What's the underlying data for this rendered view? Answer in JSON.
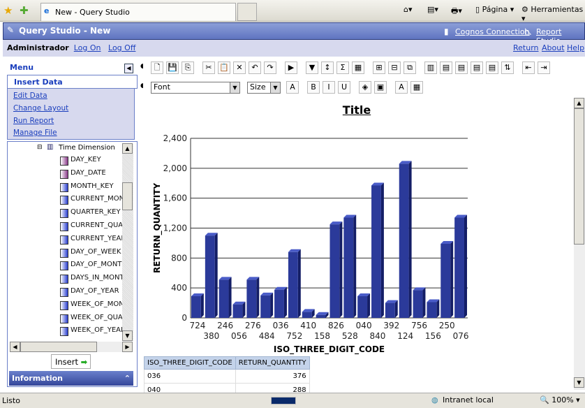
{
  "browser": {
    "tab_title": "New - Query Studio",
    "pagina": "Página",
    "herramientas": "Herramientas"
  },
  "header": {
    "title": "Query Studio - New",
    "cognos_connection": "Cognos Connection",
    "report_studio": "Report Studio"
  },
  "userbar": {
    "user": "Administrador",
    "log_on": "Log On",
    "log_off": "Log Off",
    "return": "Return",
    "about": "About",
    "help": "Help"
  },
  "menu": {
    "title": "Menu",
    "items": [
      "Insert Data",
      "Edit Data",
      "Change Layout",
      "Run Report",
      "Manage File"
    ]
  },
  "tree": {
    "root": "Time Dimension",
    "items": [
      "DAY_KEY",
      "DAY_DATE",
      "MONTH_KEY",
      "CURRENT_MONTH",
      "QUARTER_KEY",
      "CURRENT_QUARTER",
      "CURRENT_YEAR",
      "DAY_OF_WEEK",
      "DAY_OF_MONTH",
      "DAYS_IN_MONTH",
      "DAY_OF_YEAR",
      "WEEK_OF_MONTH",
      "WEEK_OF_QUARTER",
      "WEEK_OF_YEAR"
    ]
  },
  "insert_label": "Insert",
  "information_label": "Information",
  "format": {
    "font": "Font",
    "size": "Size"
  },
  "report": {
    "title": "Title"
  },
  "chart_data": {
    "type": "bar",
    "xlabel": "ISO_THREE_DIGIT_CODE",
    "ylabel": "RETURN_QUANTITY",
    "ylim": [
      0,
      2400
    ],
    "yticks": [
      "0",
      "400",
      "800",
      "1,200",
      "1,600",
      "2,000",
      "2,400"
    ],
    "grid": true,
    "categories": [
      "724",
      "380",
      "246",
      "056",
      "276",
      "484",
      "036",
      "752",
      "410",
      "158",
      "826",
      "528",
      "040",
      "840",
      "392",
      "124",
      "756",
      "156",
      "250",
      "076"
    ],
    "values": [
      290,
      1100,
      510,
      180,
      510,
      300,
      376,
      880,
      80,
      40,
      1250,
      1340,
      290,
      1770,
      200,
      2060,
      370,
      210,
      990,
      1340
    ],
    "color": "#2b3a9a"
  },
  "table": {
    "headers": [
      "ISO_THREE_DIGIT_CODE",
      "RETURN_QUANTITY"
    ],
    "rows": [
      [
        "036",
        "376"
      ],
      [
        "040",
        "288"
      ]
    ]
  },
  "status": {
    "text": "Listo",
    "zone": "Intranet local",
    "zoom": "100%"
  }
}
